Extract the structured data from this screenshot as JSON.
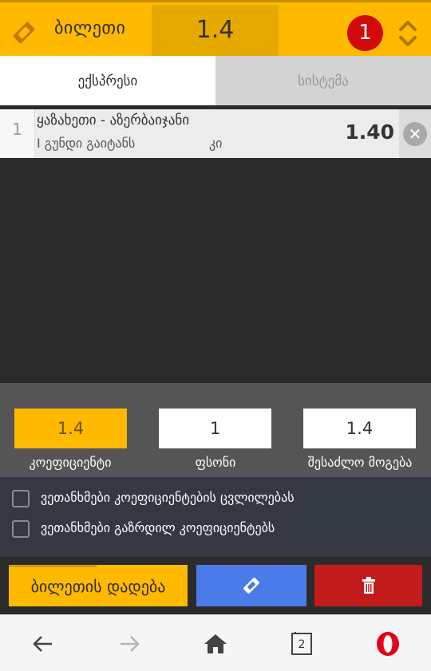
{
  "header": {
    "title": "ბილეთი",
    "total_odds": "1.4",
    "selection_count": "1",
    "icons": {
      "ticket": "ticket-icon",
      "toggle": "expand-collapse-icon"
    },
    "colors": {
      "background": "#ffb900",
      "odds_box": "#e5a900",
      "count_badge": "#d20a0a"
    }
  },
  "tabs": [
    {
      "label": "ექსპრესი",
      "active": true
    },
    {
      "label": "სისტემა",
      "active": false
    }
  ],
  "bets": [
    {
      "index": "1",
      "match": "ყაზახეთი - აზერბაიჯანი",
      "market": "I გუნდი გაიტანს",
      "choice": "კი",
      "odds": "1.40",
      "remove_icon": "close-circle-icon"
    }
  ],
  "stake": {
    "coefficient": {
      "value": "1.4",
      "label": "კოეფიციენტი"
    },
    "amount": {
      "value": "1",
      "label": "ფსონი"
    },
    "possible_win": {
      "value": "1.4",
      "label": "შესაძლო მოგება"
    }
  },
  "options": [
    {
      "label": "ვეთანხმები კოეფიციენტების ცვლილებას",
      "checked": false
    },
    {
      "label": "ვეთანხმები გაზრდილ კოეფიციენტებს",
      "checked": false
    }
  ],
  "actions": {
    "place_bet_label": "ბილეთის დადება",
    "ticket_icon": "ticket-icon",
    "delete_icon": "trash-icon",
    "colors": {
      "place": "#ffb900",
      "ticket": "#4a7be8",
      "delete": "#c21b1b"
    }
  },
  "browser_nav": {
    "tabs_count": "2",
    "icons": [
      "back-arrow-icon",
      "forward-arrow-icon",
      "home-icon",
      "tabs-icon",
      "opera-logo-icon"
    ]
  }
}
